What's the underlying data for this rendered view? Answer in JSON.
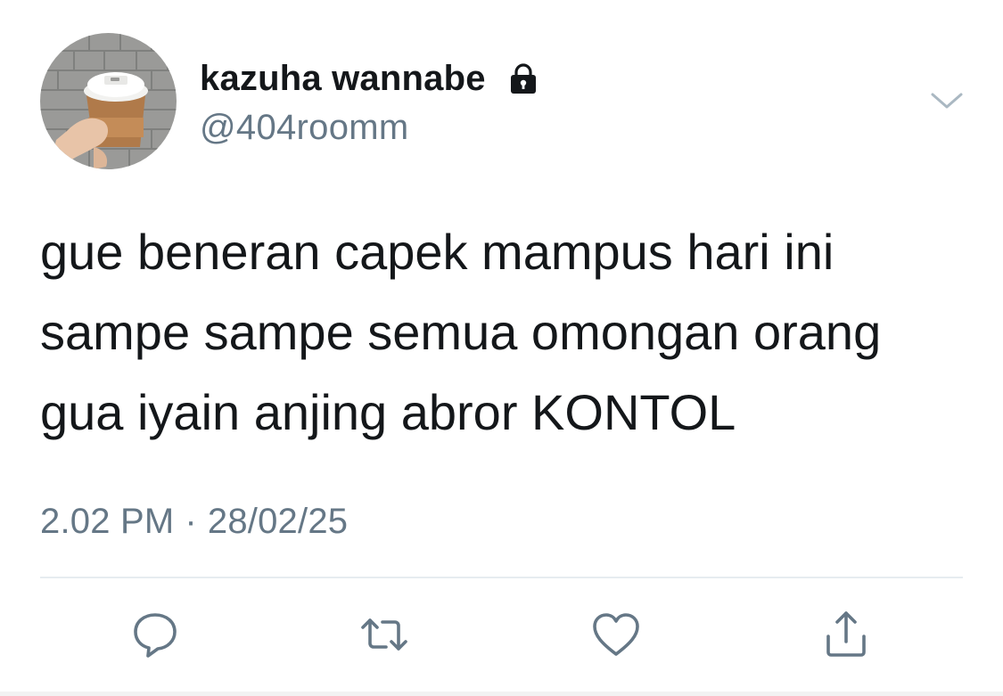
{
  "author": {
    "display_name": "kazuha wannabe",
    "handle": "@404roomm",
    "avatar_icon": "coffee-cup-avatar",
    "protected_icon": "lock-icon"
  },
  "tweet": {
    "lines": [
      "gue beneran capek mampus hari ini",
      "sampe sampe semua omongan orang",
      "gua iyain anjing abror KONTOL"
    ],
    "time": "2.02 PM",
    "separator": "·",
    "date": "28/02/25"
  },
  "actions": {
    "reply_icon": "reply-icon",
    "retweet_icon": "retweet-icon",
    "like_icon": "heart-icon",
    "share_icon": "share-icon"
  },
  "menu_icon": "chevron-down-icon",
  "colors": {
    "text": "#14171a",
    "secondary": "#657786",
    "divider": "#e6ecf0"
  }
}
